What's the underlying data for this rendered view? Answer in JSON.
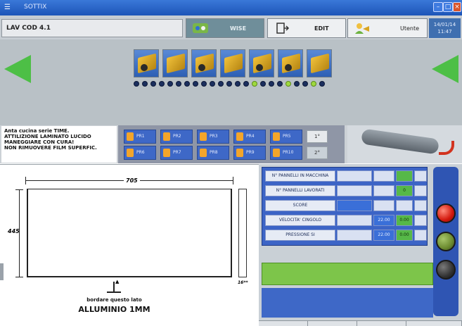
{
  "window": {
    "title": "SOTTIX"
  },
  "toolbar": {
    "lav_cod": "LAV COD 4.1",
    "wise_label": "WISE",
    "edit_label": "EDIT",
    "user_label": "Utente",
    "date": "14/01/14",
    "time": "11:47"
  },
  "navigation": {
    "left_arrow_icon": "green-arrow-left-icon",
    "right_arrow_icon": "green-arrow-right-icon",
    "tool_icons": [
      "tool-1-icon",
      "tool-2-icon",
      "tool-3-icon",
      "tool-4-icon",
      "tool-5-icon",
      "tool-6-icon",
      "tool-7-icon"
    ],
    "step_dots_total": 23,
    "step_dots_active": [
      14,
      18,
      21
    ]
  },
  "description": {
    "line1": "Anta cucina serie TIME.",
    "line2": "ATTILIZIONE LAMINATO LUCIDO",
    "line3": "MANEGGIARE CON CURA!",
    "line4": "NON RIMUOVERE FILM SUPERFIC."
  },
  "programs": {
    "row1": [
      "PR1",
      "PR2",
      "PR3",
      "PR4",
      "PR5"
    ],
    "row2": [
      "PR6",
      "PR7",
      "PR8",
      "PR9",
      "PR10"
    ],
    "face1": "1°",
    "face2": "2°"
  },
  "drawing": {
    "width_label": "705",
    "height_label": "445",
    "thickness_label": "16**",
    "edge_label": "bordare questo lato",
    "material_label": "ALLUMINIO 1MM"
  },
  "grid": {
    "rows": [
      {
        "label": "N° PANNELLI IN MACCHINA",
        "c2": "",
        "c3": "",
        "c4": "",
        "c5": ""
      },
      {
        "label": "N° PANNELLI LAVORATI",
        "c2": "",
        "c3": "",
        "c4": "0",
        "c5": ""
      },
      {
        "label": "SCORE",
        "c2": "",
        "c3": "",
        "c4": "",
        "c5": ""
      },
      {
        "label": "VELOCITA' CINGOLO",
        "c2": "",
        "c3": "22.00",
        "c4": "0.00",
        "c5": ""
      },
      {
        "label": "PRESSIONE SI",
        "c2": "",
        "c3": "22.00",
        "c4": "0.00",
        "c5": ""
      }
    ]
  },
  "colors": {
    "accent_green": "#4dbf46",
    "panel_blue": "#3e68c7",
    "status_red": "#d3180c"
  }
}
